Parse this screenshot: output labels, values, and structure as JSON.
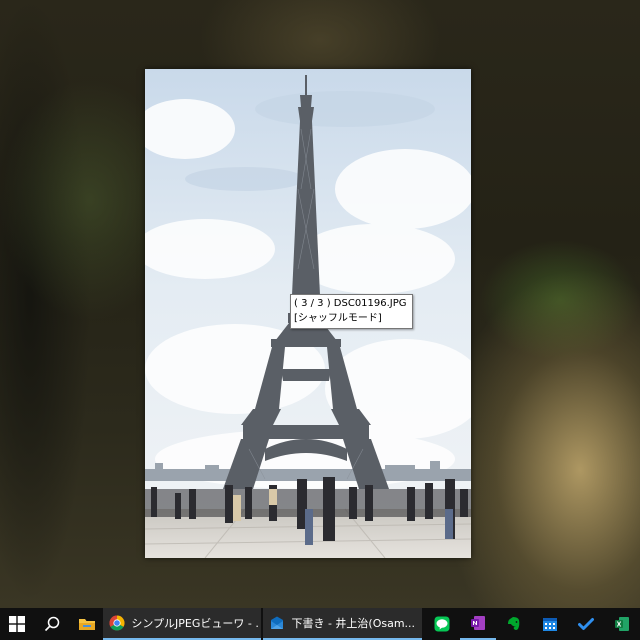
{
  "viewer": {
    "tooltip": {
      "line1": "( 3 / 3 ) DSC01196.JPG",
      "line2": "[シャッフルモード]"
    }
  },
  "taskbar": {
    "apps": [
      {
        "icon": "chrome-icon",
        "label": "シンプルJPEGビューワ - ..."
      },
      {
        "icon": "mail-icon",
        "label": "下書き - 井上治(Osam..."
      }
    ],
    "pinned": [
      "line-icon",
      "onenote-icon",
      "evernote-icon",
      "calendar-icon",
      "todo-icon",
      "excel-icon"
    ]
  },
  "colors": {
    "taskbar_bg": "#101010",
    "active_indicator": "#76b9ed",
    "sky": "#dfe8f2",
    "tower": "#5a5f66"
  }
}
